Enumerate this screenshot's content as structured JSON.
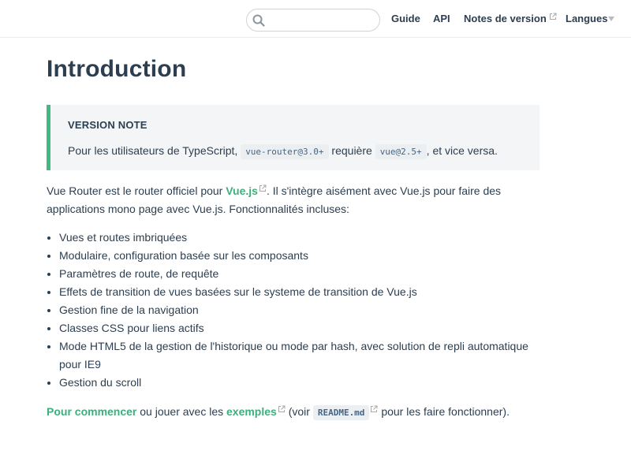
{
  "navbar": {
    "search": {
      "value": "",
      "placeholder": ""
    },
    "links": {
      "guide": "Guide",
      "api": "API",
      "release_notes": "Notes de version",
      "languages": "Langues"
    }
  },
  "page": {
    "title": "Introduction",
    "tip": {
      "title": "VERSION NOTE",
      "text_before": "Pour les utilisateurs de TypeScript, ",
      "code1": "vue-router@3.0+",
      "text_middle": " requière ",
      "code2": "vue@2.5+",
      "text_after": ", et vice versa."
    },
    "intro": {
      "text_before": "Vue Router est le router officiel pour ",
      "link": "Vue.js",
      "text_after": ". Il s'intègre aisément avec Vue.js pour faire des applications mono page avec Vue.js. Fonctionnalités incluses:"
    },
    "features": [
      "Vues et routes imbriquées",
      "Modulaire, configuration basée sur les composants",
      "Paramètres de route, de requête",
      "Effets de transition de vues basées sur le systeme de transition de Vue.js",
      "Gestion fine de la navigation",
      "Classes CSS pour liens actifs",
      "Mode HTML5 de la gestion de l'historique ou mode par hash, avec solution de repli automatique pour IE9",
      "Gestion du scroll"
    ],
    "footer": {
      "link1": "Pour commencer",
      "text1": " ou jouer avec les ",
      "link2": "exemples",
      "text2": " (voir ",
      "code": "README.md",
      "text3": " pour les faire fonctionner)."
    }
  },
  "colors": {
    "accent": "#42b983",
    "link": "#3eaf7c",
    "text": "#2c3e50",
    "tip_background": "#f3f5f7"
  },
  "icons": {
    "search": "search-icon",
    "external": "external-link-icon",
    "dropdown": "chevron-down-icon"
  }
}
